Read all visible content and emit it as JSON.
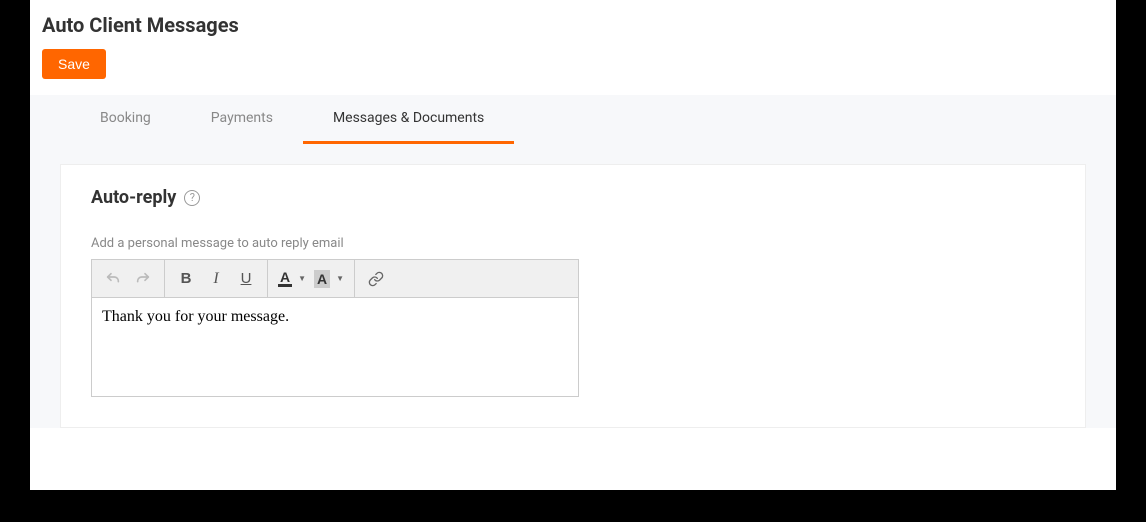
{
  "header": {
    "title": "Auto Client Messages",
    "save_label": "Save"
  },
  "tabs": [
    {
      "label": "Booking",
      "active": false
    },
    {
      "label": "Payments",
      "active": false
    },
    {
      "label": "Messages & Documents",
      "active": true
    }
  ],
  "section": {
    "title": "Auto-reply",
    "help_glyph": "?",
    "editor_label": "Add a personal message to auto reply email",
    "content": "Thank you for your message."
  },
  "toolbar": {
    "undo": "↶",
    "redo": "↷",
    "bold": "B",
    "italic": "I",
    "underline": "U",
    "font_color": "A",
    "bg_color": "A",
    "caret": "▼"
  }
}
